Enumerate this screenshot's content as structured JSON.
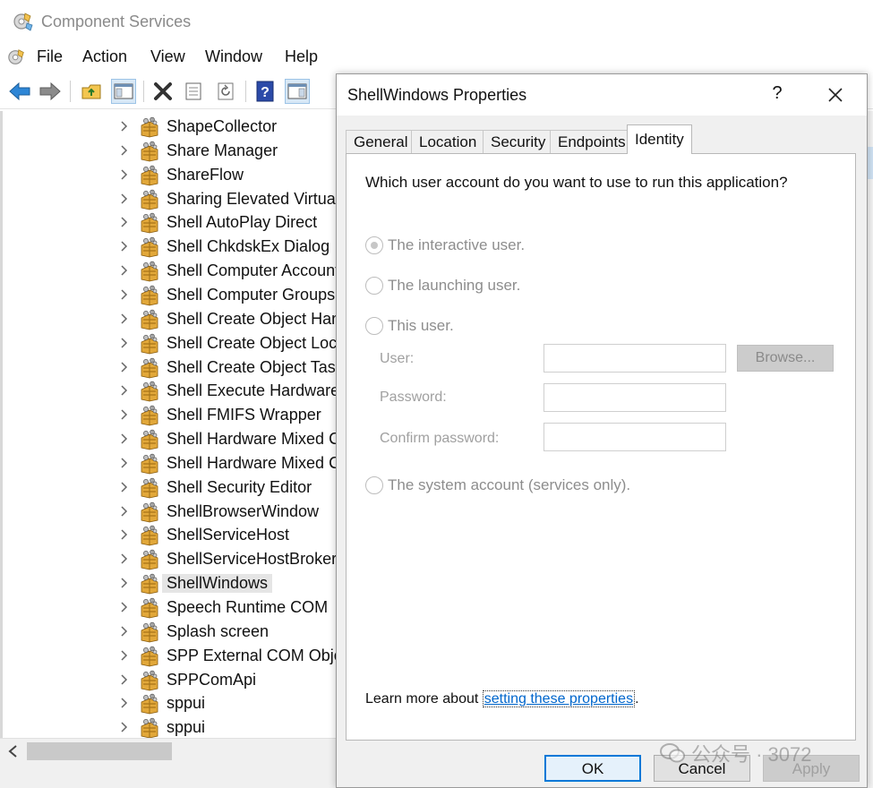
{
  "window": {
    "title": "Component Services"
  },
  "menubar": {
    "items": [
      "File",
      "Action",
      "View",
      "Window",
      "Help"
    ]
  },
  "toolbar": {
    "icons": [
      "back-arrow-icon",
      "forward-arrow-icon",
      "up-folder-icon",
      "show-hide-tree-icon",
      "delete-icon",
      "properties-icon",
      "refresh-icon",
      "help-icon",
      "view-pane-icon"
    ]
  },
  "tree": {
    "items": [
      "ShapeCollector",
      "Share Manager",
      "ShareFlow",
      "Sharing Elevated Virtual I",
      "Shell AutoPlay Direct",
      "Shell ChkdskEx Dialog",
      "Shell Computer Account",
      "Shell Computer Groups",
      "Shell Create Object Hand",
      "Shell Create Object Loca",
      "Shell Create Object Task",
      "Shell Execute Hardware E",
      "Shell FMIFS Wrapper",
      "Shell Hardware Mixed Co",
      "Shell Hardware Mixed Co",
      "Shell Security Editor",
      "ShellBrowserWindow",
      "ShellServiceHost",
      "ShellServiceHostBrokerP",
      "ShellWindows",
      "Speech Runtime COM",
      "Splash screen",
      "SPP External COM Objec",
      "SPPComApi",
      "sppui",
      "sppui"
    ],
    "selected_item": "ShellWindows"
  },
  "dialog": {
    "title": "ShellWindows Properties",
    "help_glyph": "?",
    "tabs": [
      "General",
      "Location",
      "Security",
      "Endpoints",
      "Identity"
    ],
    "active_tab": "Identity",
    "question": "Which user account do you want to use to run this application?",
    "options": {
      "interactive": "The interactive user.",
      "launching": "The launching user.",
      "this_user": "This user.",
      "system": "The system account (services only)."
    },
    "selected_option": "The interactive user.",
    "fields": {
      "user_label": "User:",
      "user_value": "",
      "password_label": "Password:",
      "password_value": "",
      "confirm_label": "Confirm password:",
      "confirm_value": ""
    },
    "browse_label": "Browse...",
    "learn_prefix": "Learn more about ",
    "learn_link": "setting these properties",
    "learn_suffix": ".",
    "buttons": {
      "ok": "OK",
      "cancel": "Cancel",
      "apply": "Apply"
    }
  },
  "watermark": {
    "text": "公众号 · 3072"
  },
  "colors": {
    "accent": "#0078d7",
    "link": "#0066cc",
    "selection": "#e5e5e5",
    "dialog_bg": "#f0f0f0"
  }
}
